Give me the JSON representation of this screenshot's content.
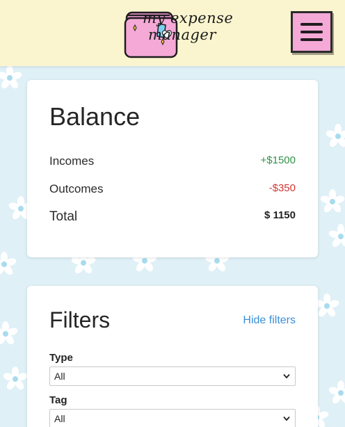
{
  "header": {
    "logo_line1": "my expense",
    "logo_line2": "manager",
    "menu_icon": "hamburger-menu-icon",
    "logo_icon": "wallet-icon"
  },
  "colors": {
    "header_bg": "#faf5cf",
    "page_bg": "#dff0f7",
    "accent_pink": "#f4a9d6",
    "income": "#2e9448",
    "outcome": "#d43434",
    "link": "#3a8fd8"
  },
  "balance": {
    "title": "Balance",
    "incomes_label": "Incomes",
    "incomes_value": "+$1500",
    "outcomes_label": "Outcomes",
    "outcomes_value": "-$350",
    "total_label": "Total",
    "total_value": "$ 1150"
  },
  "filters": {
    "title": "Filters",
    "hide_link": "Hide filters",
    "type_label": "Type",
    "type_selected": "All",
    "tag_label": "Tag",
    "tag_selected": "All"
  }
}
